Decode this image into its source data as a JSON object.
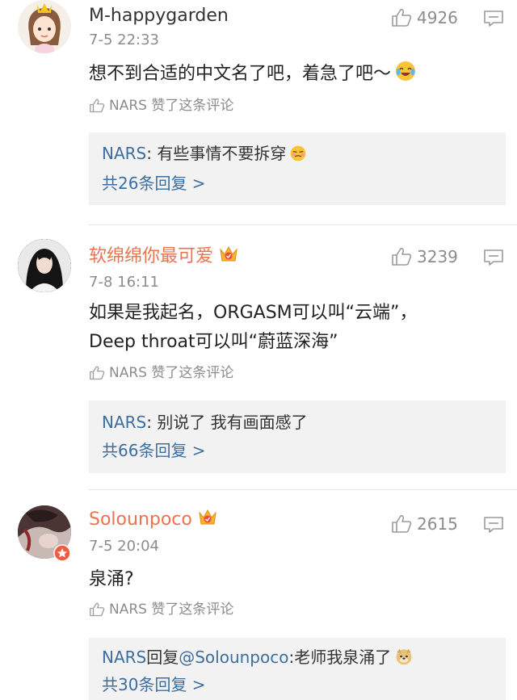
{
  "comments": [
    {
      "username": "M-happygarden",
      "time": "7-5 22:33",
      "likes": "4926",
      "text": "想不到合适的中文名了吧，着急了吧～",
      "liked_by": "NARS 赞了这条评论",
      "reply": {
        "author": "NARS",
        "text": ": 有些事情不要拆穿",
        "more": "共26条回复 >"
      }
    },
    {
      "username": "软绵绵你最可爱",
      "time": "7-8 16:11",
      "likes": "3239",
      "text_line1": "如果是我起名，ORGASM可以叫“云端”，",
      "text_line2": "Deep throat可以叫“蔚蓝深海”",
      "liked_by": "NARS 赞了这条评论",
      "reply": {
        "author": "NARS",
        "text": ": 别说了 我有画面感了",
        "more": "共66条回复 >"
      }
    },
    {
      "username": "Solounpoco",
      "time": "7-5 20:04",
      "likes": "2615",
      "text": "泉涌?",
      "liked_by": "NARS 赞了这条评论",
      "reply": {
        "author": "NARS",
        "verb": "回复",
        "mention": "@Solounpoco",
        "text": ":老师我泉涌了",
        "more": "共30条回复 >"
      }
    }
  ]
}
